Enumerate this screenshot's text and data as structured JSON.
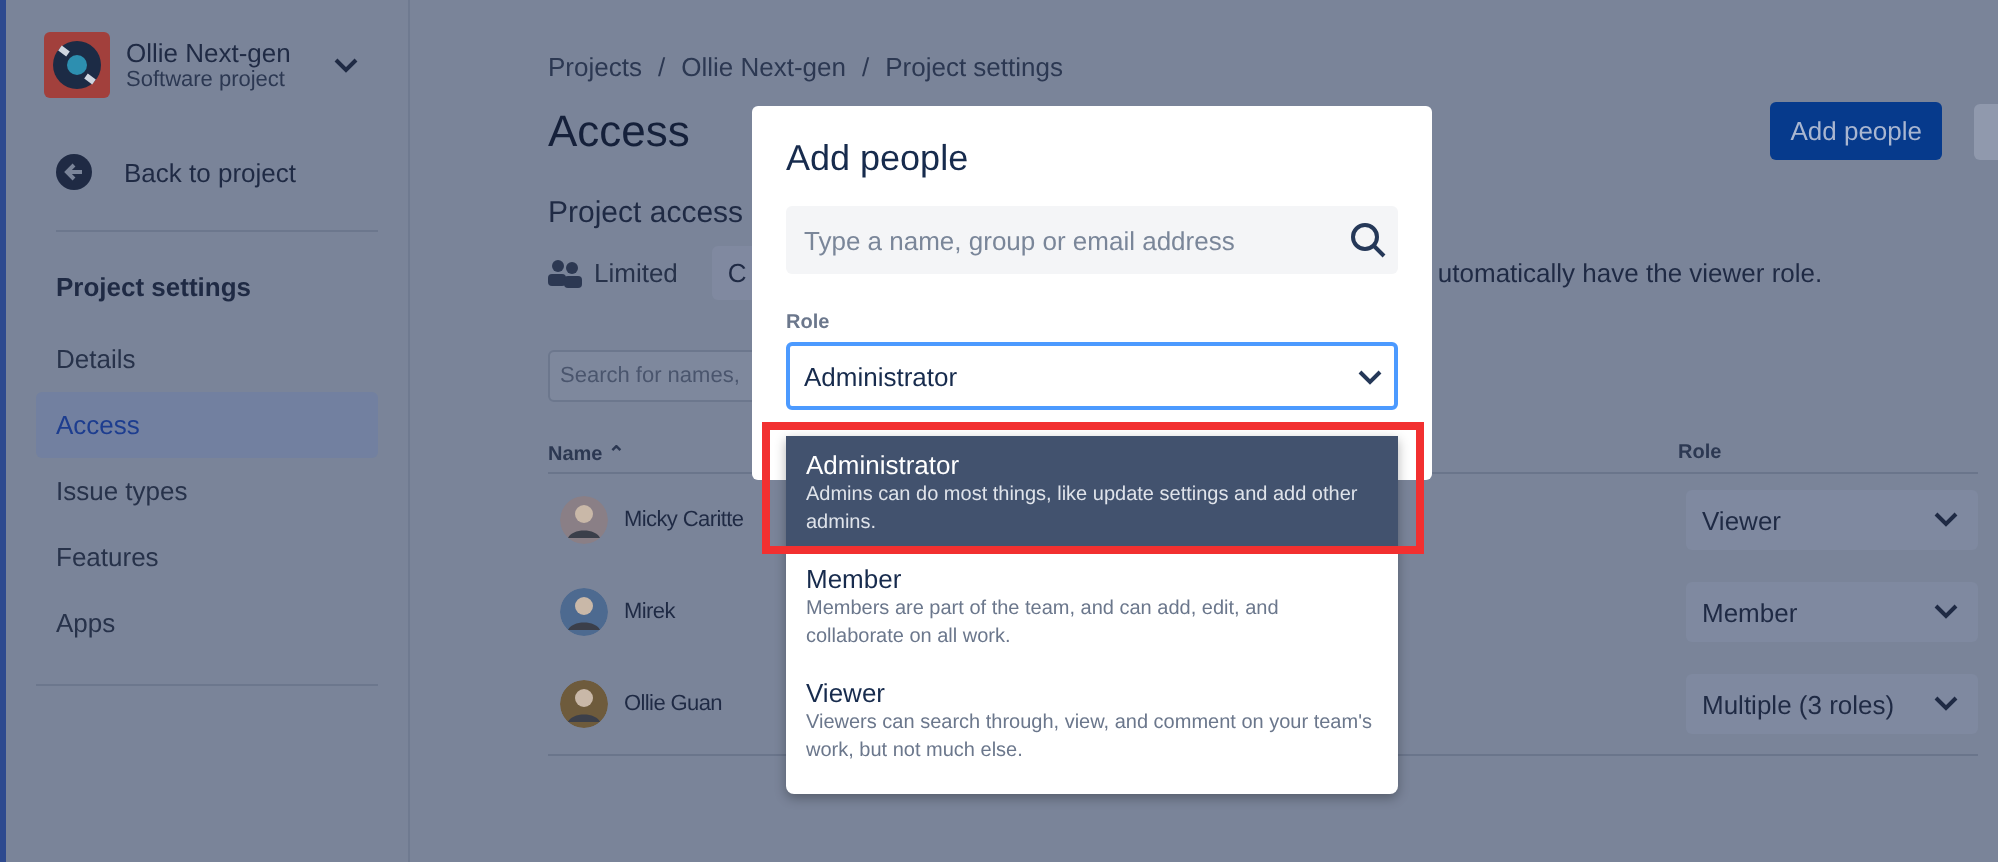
{
  "sidebar": {
    "project": {
      "name": "Ollie Next-gen",
      "type": "Software project"
    },
    "back_link": "Back to project",
    "section_title": "Project settings",
    "items": [
      {
        "label": "Details",
        "selected": false
      },
      {
        "label": "Access",
        "selected": true
      },
      {
        "label": "Issue types",
        "selected": false
      },
      {
        "label": "Features",
        "selected": false
      },
      {
        "label": "Apps",
        "selected": false
      }
    ]
  },
  "main": {
    "breadcrumbs": [
      {
        "label": "Projects"
      },
      {
        "separator": "/",
        "label": "Ollie Next-gen"
      },
      {
        "separator": "/",
        "label": "Project settings"
      }
    ],
    "title": "Access",
    "add_button": "Add people",
    "project_access": {
      "heading": "Project access",
      "level": "Limited",
      "change_button": "C",
      "note": "utomatically have the viewer role."
    },
    "search": {
      "placeholder": "Search for names,"
    },
    "table": {
      "columns": [
        {
          "label": "Name",
          "sort_indicator": "⌃"
        },
        {
          "label": "Role"
        }
      ],
      "rows": [
        {
          "name": "Micky Caritte",
          "role": "Viewer"
        },
        {
          "name": "Mirek",
          "role": "Member"
        },
        {
          "name": "Ollie Guan",
          "role": "Multiple (3 roles)"
        }
      ]
    }
  },
  "modal": {
    "title": "Add people",
    "search_placeholder": "Type a name, group or email address",
    "role_label": "Role",
    "role_value": "Administrator",
    "options": [
      {
        "title": "Administrator",
        "description": "Admins can do most things, like update settings and add other admins.",
        "selected": true
      },
      {
        "title": "Member",
        "description": "Members are part of the team, and can add, edit, and collaborate on all work.",
        "selected": false
      },
      {
        "title": "Viewer",
        "description": "Viewers can search through, view, and comment on your team's work, but not much else.",
        "selected": false
      }
    ]
  }
}
